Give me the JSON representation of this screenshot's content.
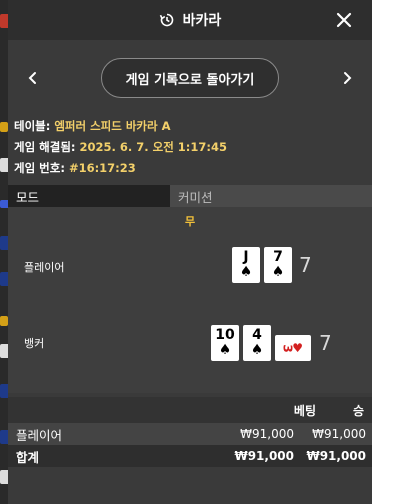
{
  "header": {
    "title": "바카라"
  },
  "navigation": {
    "back_label": "게임 기록으로 돌아가기"
  },
  "info": {
    "table_label": "테이블: ",
    "table_value": "엠퍼러 스피드 바카라 A",
    "settled_label": "게임 해결됨: ",
    "settled_value": "2025. 6. 7. 오전 1:17:45",
    "game_no_label": "게임 번호: ",
    "game_no_value": "#16:17:23"
  },
  "tabs": {
    "mode": "모드",
    "commission": "커미션"
  },
  "result": {
    "outcome": "무",
    "player_label": "플레이어",
    "banker_label": "뱅커",
    "player_score": "7",
    "banker_score": "7",
    "player_cards": [
      {
        "rank": "J",
        "suit": "♠"
      },
      {
        "rank": "7",
        "suit": "♠"
      }
    ],
    "banker_cards": [
      {
        "rank": "10",
        "suit": "♠"
      },
      {
        "rank": "4",
        "suit": "♠"
      },
      {
        "rank": "3",
        "suit": "♥"
      }
    ]
  },
  "bets": {
    "header_bet": "베팅",
    "header_win": "승",
    "rows": [
      {
        "name": "플레이어",
        "bet": "₩91,000",
        "win": "₩91,000"
      }
    ],
    "total": {
      "name": "합계",
      "bet": "₩91,000",
      "win": "₩91,000"
    }
  },
  "colors": {
    "panel_bg": "#3a3a3a",
    "accent_gold": "#f3d06a",
    "outcome_yellow": "#f3c13a",
    "heart_red": "#d32020"
  }
}
